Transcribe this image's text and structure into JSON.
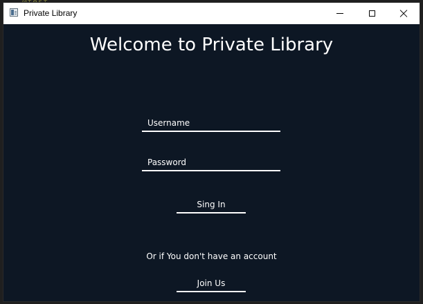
{
  "desktop": {
    "background_text": "@test"
  },
  "window": {
    "title": "Private Library",
    "app_icon": "app-window-icon",
    "controls": {
      "minimize": "minimize-icon",
      "maximize": "maximize-icon",
      "close": "close-icon"
    }
  },
  "login": {
    "heading": "Welcome to Private Library",
    "username_placeholder": "Username",
    "username_value": "",
    "password_placeholder": "Password",
    "password_value": "",
    "signin_label": "Sing In",
    "no_account_text": "Or if You don't have an account",
    "join_label": "Join Us"
  },
  "colors": {
    "background": "#0d1724",
    "text": "#ffffff",
    "underline": "#ffffff",
    "titlebar": "#ffffff"
  }
}
